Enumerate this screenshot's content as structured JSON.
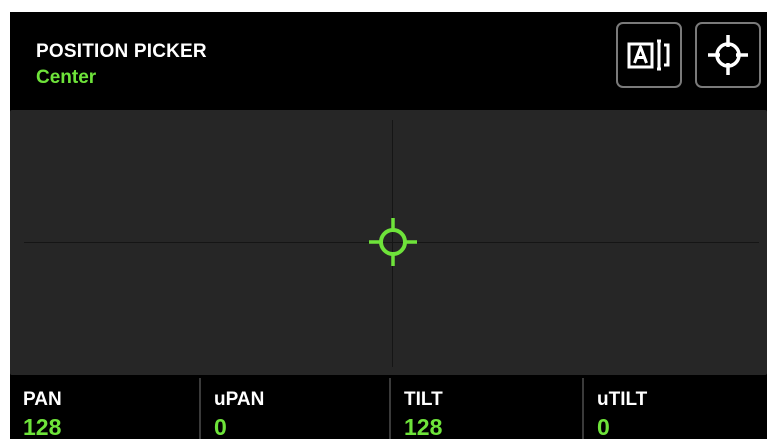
{
  "header": {
    "title": "POSITION PICKER",
    "subtitle": "Center",
    "buttons": [
      {
        "icon": "text-bracket-a-icon"
      },
      {
        "icon": "crosshair-icon"
      }
    ]
  },
  "picker": {
    "cursor_icon": "crosshair-icon",
    "cursor_position": {
      "pan_fraction": 0.5,
      "tilt_fraction": 0.5
    }
  },
  "footer": {
    "fields": [
      {
        "label": "PAN",
        "value": "128"
      },
      {
        "label": "uPAN",
        "value": "0"
      },
      {
        "label": "TILT",
        "value": "128"
      },
      {
        "label": "uTILT",
        "value": "0"
      }
    ]
  },
  "colors": {
    "accent": "#6ee33a",
    "background": "#000000",
    "picker_area": "#262626",
    "button_border": "#7a7a7a"
  }
}
